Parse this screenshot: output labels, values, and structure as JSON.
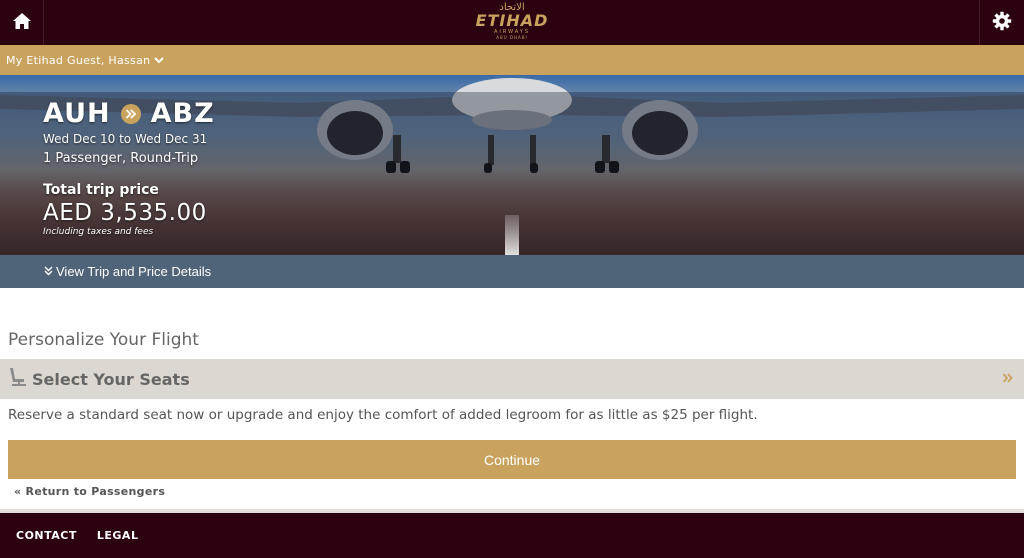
{
  "header": {
    "home_icon": "home-icon",
    "settings_icon": "gear-icon",
    "logo": {
      "arabic": "الاتحاد",
      "name": "ETIHAD",
      "sub": "AIRWAYS",
      "city": "ABU DHABI"
    }
  },
  "guest": {
    "label": "My Etihad Guest, Hassan",
    "icon": "chevron-down-icon"
  },
  "trip": {
    "origin": "AUH",
    "destination": "ABZ",
    "dates": "Wed Dec 10 to Wed Dec 31",
    "passengers": "1 Passenger, Round-Trip",
    "total_label": "Total trip price",
    "total_amount": "AED 3,535.00",
    "taxes_note": "Including taxes and fees"
  },
  "details_link": "View Trip and Price Details",
  "personalize": {
    "title": "Personalize Your Flight",
    "seats_title": "Select Your Seats",
    "seats_icon": "seat-icon",
    "expand_icon": "double-chevron-right-icon",
    "seats_desc": "Reserve a standard seat now or upgrade and enjoy the comfort of added legroom for as little as $25 per flight."
  },
  "actions": {
    "continue_label": "Continue",
    "return_label": "Return to Passengers",
    "return_prefix": "«"
  },
  "footer": {
    "contact": "CONTACT",
    "legal": "LEGAL"
  },
  "colors": {
    "brand_dark": "#2d0210",
    "gold": "#c9a35e",
    "slate": "#4f6479",
    "panel": "#dcd8d1"
  }
}
